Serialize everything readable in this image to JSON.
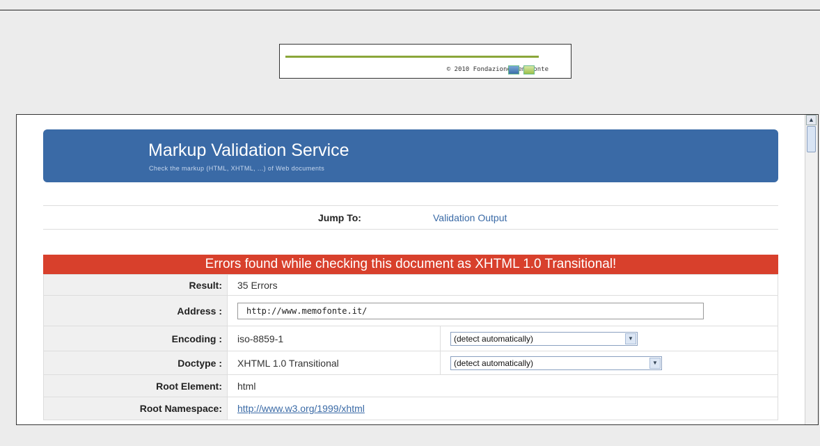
{
  "footer": {
    "copyright": "© 2010 Fondazione Memofonte"
  },
  "banner": {
    "title": "Markup Validation Service",
    "subtitle": "Check the markup (HTML, XHTML, ...) of Web documents"
  },
  "jump": {
    "label": "Jump To:",
    "link": "Validation Output"
  },
  "errors_header": "Errors found while checking this document as XHTML 1.0 Transitional!",
  "results": {
    "result_label": "Result:",
    "result_value": "35 Errors",
    "address_label": "Address :",
    "address_value": "http://www.memofonte.it/",
    "encoding_label": "Encoding :",
    "encoding_value": "iso-8859-1",
    "encoding_select": "(detect automatically)",
    "doctype_label": "Doctype :",
    "doctype_value": "XHTML 1.0 Transitional",
    "doctype_select": "(detect automatically)",
    "root_element_label": "Root Element:",
    "root_element_value": "html",
    "root_namespace_label": "Root Namespace:",
    "root_namespace_value": "http://www.w3.org/1999/xhtml"
  },
  "colors": {
    "banner": "#3a6aa6",
    "error_header": "#d8402c",
    "error_text": "#c83c24"
  }
}
